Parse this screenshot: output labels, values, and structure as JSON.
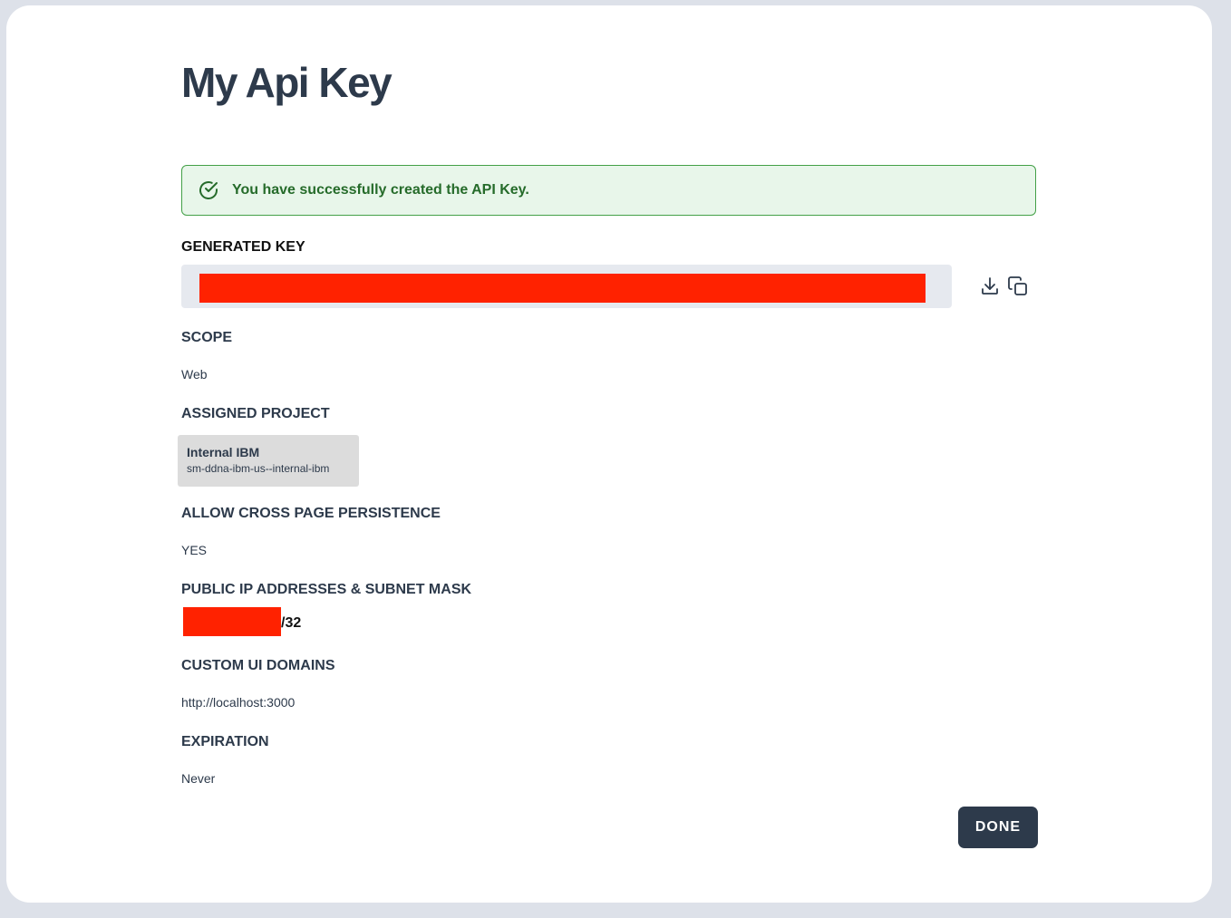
{
  "page": {
    "title": "My Api Key"
  },
  "alert": {
    "icon": "check-circle-icon",
    "message": "You have successfully created the API Key.",
    "colors": {
      "background": "#e8f6ea",
      "border": "#43a047",
      "text": "#256b2a"
    }
  },
  "generated_key": {
    "label": "GENERATED KEY",
    "value_redacted": true,
    "actions": [
      {
        "name": "download",
        "icon": "download-icon"
      },
      {
        "name": "copy",
        "icon": "copy-icon"
      }
    ]
  },
  "scope": {
    "label": "SCOPE",
    "value": "Web"
  },
  "assigned_project": {
    "label": "ASSIGNED PROJECT",
    "name": "Internal IBM",
    "id": "sm-ddna-ibm-us--internal-ibm"
  },
  "cross_page_persistence": {
    "label": "ALLOW CROSS PAGE PERSISTENCE",
    "value": "YES"
  },
  "public_ip": {
    "label": "PUBLIC IP ADDRESSES & SUBNET MASK",
    "value_redacted": true,
    "suffix": "/32"
  },
  "custom_ui_domains": {
    "label": "CUSTOM UI DOMAINS",
    "value": "http://localhost:3000"
  },
  "expiration": {
    "label": "EXPIRATION",
    "value": "Never"
  },
  "actions": {
    "done_label": "DONE"
  },
  "colors": {
    "page_background": "#dde1e9",
    "card_background": "#ffffff",
    "primary_text": "#2d3a4b",
    "button_background": "#2d3a4b",
    "redaction": "#ff2200"
  }
}
